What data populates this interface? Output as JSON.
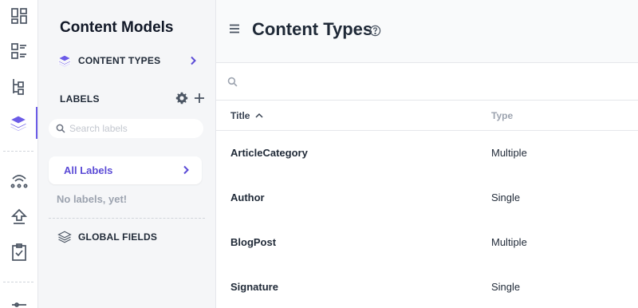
{
  "colors": {
    "accent": "#6c5ce7",
    "icon_gray": "#4b5563",
    "panel_bg": "#f5f6f8",
    "muted": "#9ca3af"
  },
  "rail": {
    "items": [
      {
        "icon": "dashboard-icon"
      },
      {
        "icon": "content-list-icon"
      },
      {
        "icon": "content-tree-icon"
      },
      {
        "icon": "content-models-layers-icon",
        "active": true
      },
      {
        "icon": "webhooks-icon"
      },
      {
        "icon": "deploy-upload-icon"
      },
      {
        "icon": "tasks-clipboard-icon"
      },
      {
        "icon": "settings-partial-icon"
      }
    ]
  },
  "sidebar": {
    "title": "Content Models",
    "content_types_label": "CONTENT TYPES",
    "labels_heading": "LABELS",
    "search_placeholder": "Search labels",
    "all_labels": "All Labels",
    "empty_text": "No labels, yet!",
    "global_fields_label": "GLOBAL FIELDS"
  },
  "main": {
    "title": "Content Types",
    "search_placeholder": "",
    "table": {
      "columns": [
        "Title",
        "Type"
      ],
      "sort": "Title ascending",
      "rows": [
        {
          "title": "ArticleCategory",
          "type": "Multiple"
        },
        {
          "title": "Author",
          "type": "Single"
        },
        {
          "title": "BlogPost",
          "type": "Multiple"
        },
        {
          "title": "Signature",
          "type": "Single"
        }
      ]
    }
  }
}
